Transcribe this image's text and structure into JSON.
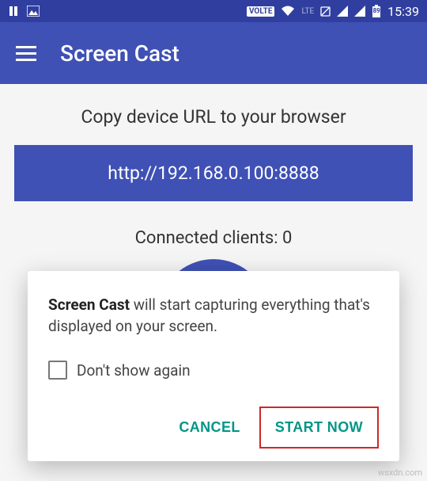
{
  "statusbar": {
    "volte": "VOLTE",
    "lte": "LTE",
    "battery": "89",
    "time": "15:39"
  },
  "appbar": {
    "title": "Screen Cast"
  },
  "main": {
    "instruction": "Copy device URL to your browser",
    "url": "http://192.168.0.100:8888",
    "clients_label": "Connected clients: 0"
  },
  "dialog": {
    "strong": "Screen Cast",
    "message": " will start capturing everything that's displayed on your screen.",
    "dont_show": "Don't show again",
    "cancel": "CANCEL",
    "start": "START NOW"
  },
  "watermark": "wsxdn.com"
}
